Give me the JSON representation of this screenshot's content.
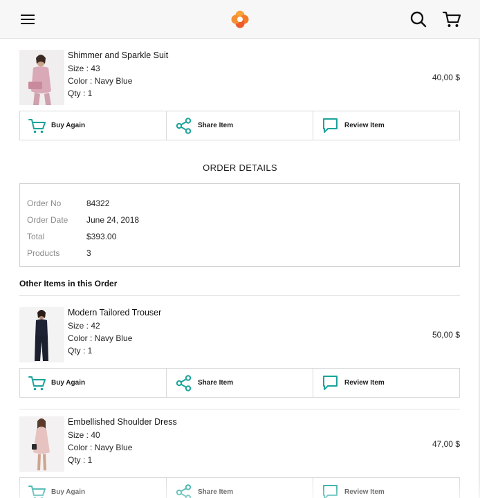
{
  "header": {
    "menu_icon": "hamburger-icon",
    "logo_icon": "flower-logo-icon",
    "search_icon": "search-icon",
    "cart_icon": "cart-icon",
    "logo_color": "#f47a2a"
  },
  "actions": {
    "buy_again": "Buy Again",
    "share_item": "Share Item",
    "review_item": "Review Item",
    "accent": "#1aa39a"
  },
  "main_item": {
    "name": "Shimmer and Sparkle Suit",
    "size": "Size : 43",
    "color": "Color : Navy Blue",
    "qty": "Qty : 1",
    "price": "40,00 $"
  },
  "order_details": {
    "title": "ORDER DETAILS",
    "rows": [
      {
        "label": "Order No",
        "value": "84322"
      },
      {
        "label": "Order Date",
        "value": "June 24, 2018"
      },
      {
        "label": "Total",
        "value": "$393.00"
      },
      {
        "label": "Products",
        "value": "3"
      }
    ]
  },
  "other_items": {
    "title": "Other Items in this Order",
    "items": [
      {
        "name": "Modern Tailored Trouser",
        "size": "Size : 42",
        "color": "Color : Navy Blue",
        "qty": "Qty : 1",
        "price": "50,00 $"
      },
      {
        "name": "Embellished Shoulder Dress",
        "size": "Size : 40",
        "color": "Color : Navy Blue",
        "qty": "Qty : 1",
        "price": "47,00 $"
      }
    ]
  }
}
